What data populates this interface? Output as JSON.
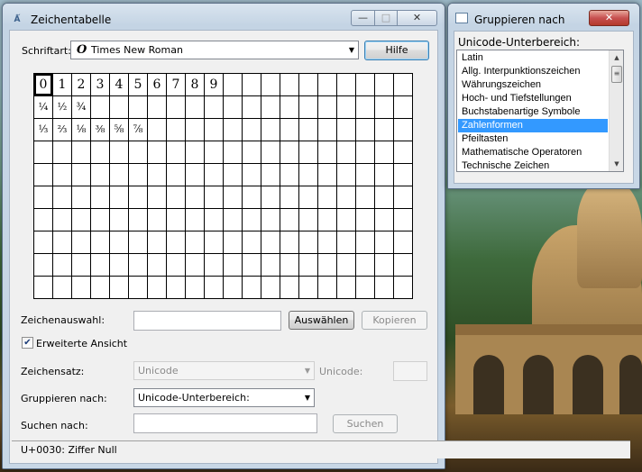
{
  "main_window": {
    "title": "Zeichentabelle",
    "app_icon_glyph": "Ǻ",
    "controls": {
      "minimize": "—",
      "maximize": "□",
      "close": "✕"
    },
    "font_label": "Schriftart:",
    "font_glyph": "O",
    "font_value": "Times New Roman",
    "help_button": "Hilfe",
    "grid": {
      "columns": 20,
      "rows": 10,
      "selected": [
        0,
        0
      ],
      "rows_content": [
        [
          "0",
          "1",
          "2",
          "3",
          "4",
          "5",
          "6",
          "7",
          "8",
          "9"
        ],
        [
          "¼",
          "½",
          "¾"
        ],
        [
          "⅓",
          "⅔",
          "⅛",
          "⅜",
          "⅝",
          "⅞"
        ]
      ]
    },
    "selection_label": "Zeichenauswahl:",
    "selection_value": "",
    "select_button": "Auswählen",
    "copy_button": "Kopieren",
    "advanced_view_label": "Erweiterte Ansicht",
    "advanced_view_checked": true,
    "charset_label": "Zeichensatz:",
    "charset_value": "Unicode",
    "unicode_label": "Unicode:",
    "unicode_value": "",
    "group_by_label": "Gruppieren nach:",
    "group_by_value": "Unicode-Unterbereich:",
    "search_label": "Suchen nach:",
    "search_value": "",
    "search_button": "Suchen",
    "status_text": "U+0030: Ziffer Null"
  },
  "group_window": {
    "title": "Gruppieren nach",
    "close": "✕",
    "list_label": "Unicode-Unterbereich:",
    "items": [
      "Latin",
      "Allg. Interpunktionszeichen",
      "Währungszeichen",
      "Hoch- und Tiefstellungen",
      "Buchstabenartige Symbole",
      "Zahlenformen",
      "Pfeiltasten",
      "Mathematische Operatoren",
      "Technische Zeichen"
    ],
    "selected_index": 5,
    "scroll_up": "▲",
    "scroll_down": "▼",
    "scroll_thumb": "≡"
  },
  "colors": {
    "selection": "#3399ff",
    "title_gradient_top": "#d9e4ef",
    "close_button": "#c75050"
  }
}
